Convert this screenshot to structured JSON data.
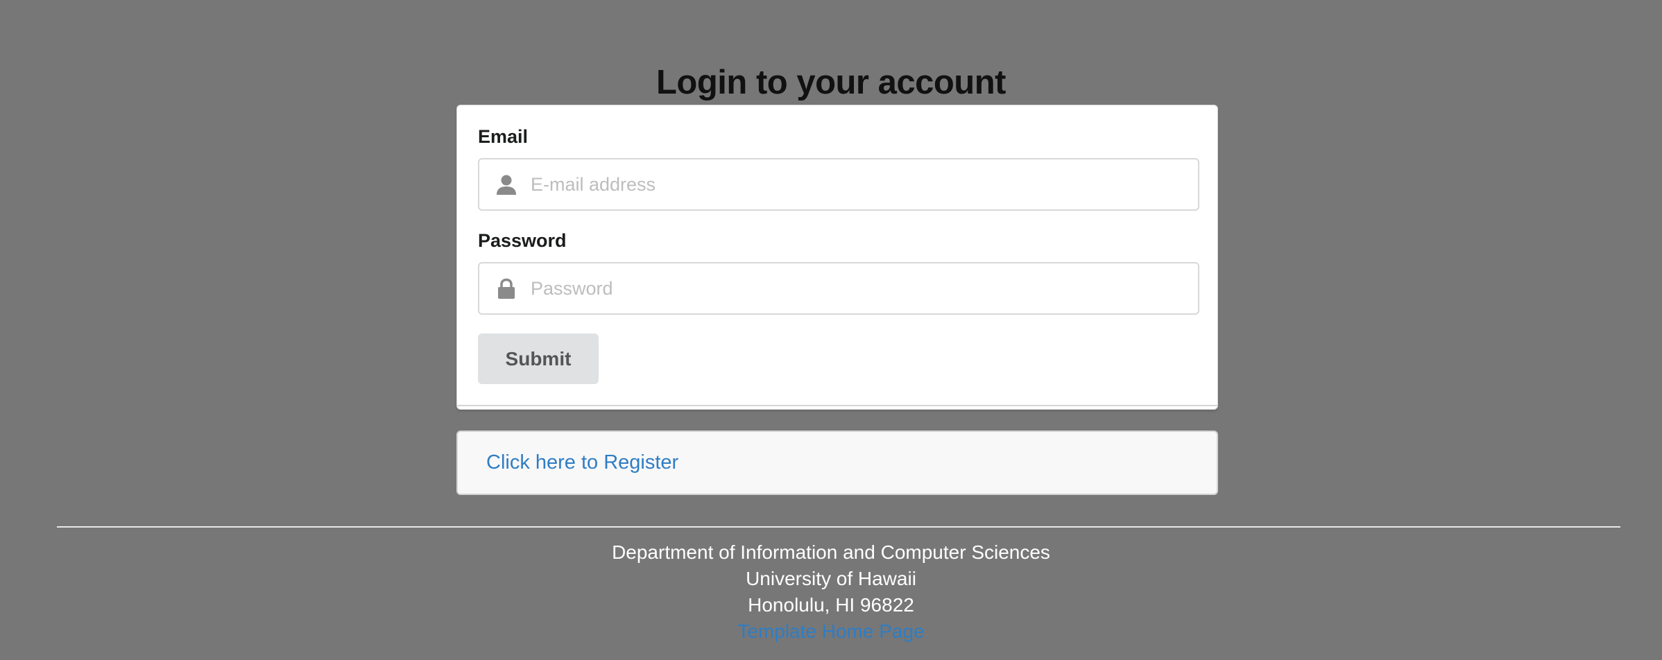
{
  "header": {
    "title": "Login to your account"
  },
  "form": {
    "email": {
      "label": "Email",
      "placeholder": "E-mail address",
      "value": "",
      "icon": "user-icon"
    },
    "password": {
      "label": "Password",
      "placeholder": "Password",
      "value": "",
      "icon": "lock-icon"
    },
    "submit_label": "Submit"
  },
  "register": {
    "link_text": "Click here to Register"
  },
  "footer": {
    "line1": "Department of Information and Computer Sciences",
    "line2": "University of Hawaii",
    "line3": "Honolulu, HI 96822",
    "link_text": "Template Home Page"
  },
  "colors": {
    "background": "#777777",
    "link": "#2f7dc4",
    "button": "#e0e1e2"
  }
}
